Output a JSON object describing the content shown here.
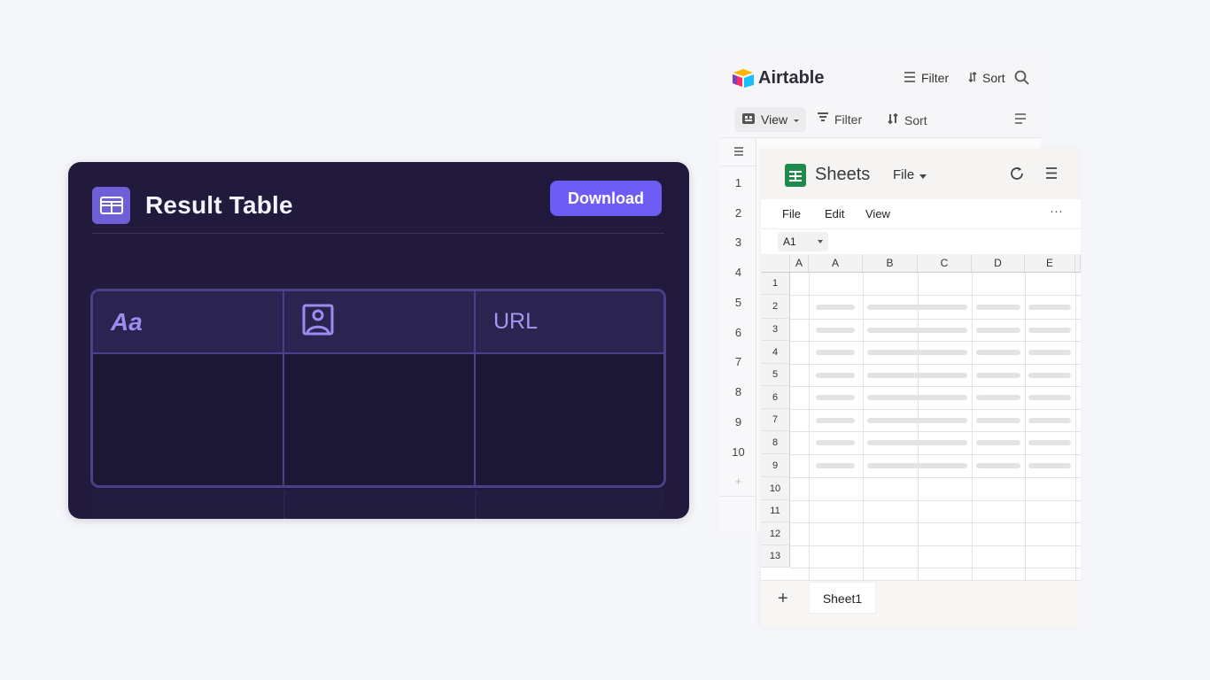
{
  "result_table": {
    "title": "Result Table",
    "download_label": "Download",
    "columns": [
      {
        "label": "Aa",
        "icon": "text-field-icon"
      },
      {
        "label": "",
        "icon": "image-icon"
      },
      {
        "label": "URL",
        "icon": ""
      }
    ],
    "colors": {
      "background": "#211a3c",
      "accent": "#6d5df4",
      "border": "#4c3f8a"
    }
  },
  "airtable": {
    "brand": "Airtable",
    "top_filter": "Filter",
    "top_sort": "Sort",
    "view_label": "View",
    "filter_label": "Filter",
    "sort_label": "Sort",
    "row_numbers": [
      "1",
      "2",
      "3",
      "4",
      "5",
      "6",
      "7",
      "8",
      "9",
      "10",
      "+"
    ]
  },
  "sheets": {
    "title": "Sheets",
    "file_menu": "File",
    "menus": [
      "File",
      "Edit",
      "View"
    ],
    "more": "···",
    "name_box": "A1",
    "columns": [
      "A",
      "A",
      "B",
      "C",
      "D",
      "E"
    ],
    "rows": [
      "1",
      "2",
      "3",
      "4",
      "5",
      "6",
      "7",
      "8",
      "9",
      "10",
      "11",
      "12",
      "13"
    ],
    "add_sheet": "+",
    "sheet_tab": "Sheet1"
  }
}
